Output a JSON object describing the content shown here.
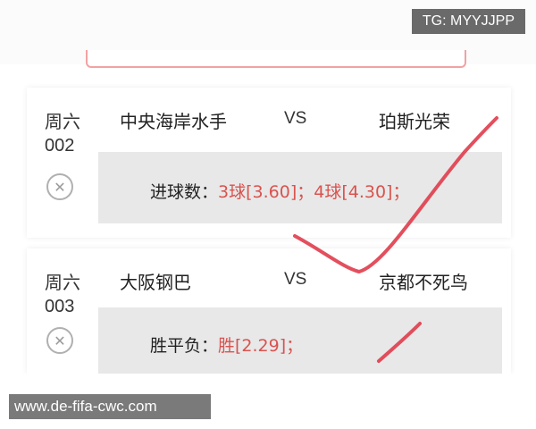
{
  "header": {
    "badge": "TG: MYYJJPP"
  },
  "matches": [
    {
      "day": "周六",
      "number": "002",
      "home": "中央海岸水手",
      "vs": "VS",
      "away": "珀斯光荣",
      "pick_label": "进球数：",
      "pick_values": "3球[3.60]；4球[4.30]；"
    },
    {
      "day": "周六",
      "number": "003",
      "home": "大阪钢巴",
      "vs": "VS",
      "away": "京都不死鸟",
      "pick_label": "胜平负：",
      "pick_values": "胜[2.29]；"
    }
  ],
  "footer": {
    "watermark": "www.de-fifa-cwc.com"
  },
  "colors": {
    "accent": "#d9534f",
    "check": "#e03c4b"
  }
}
